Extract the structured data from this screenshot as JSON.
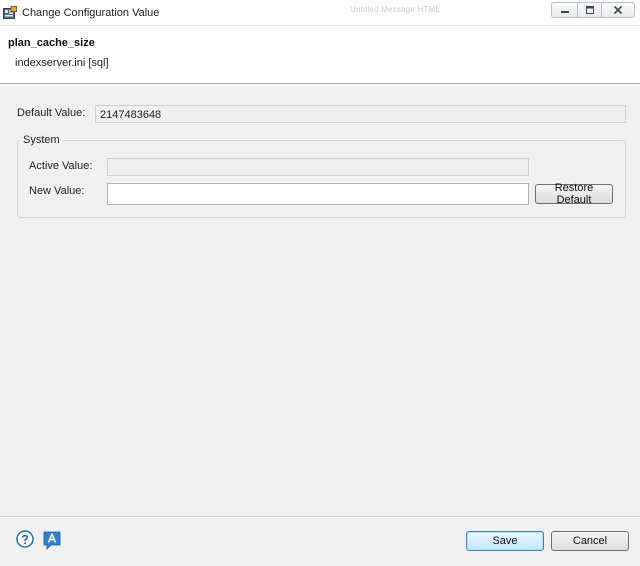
{
  "window": {
    "title": "Change Configuration Value",
    "background_hint": "Untitled Message HTML",
    "controls": {
      "minimize": "minimize-icon",
      "maximize": "maximize-icon",
      "close": "close-icon"
    }
  },
  "header": {
    "parameter_name": "plan_cache_size",
    "file_section": "indexserver.ini [sql]"
  },
  "form": {
    "default_value_label": "Default Value:",
    "default_value": "2147483648",
    "group_title": "System",
    "active_value_label": "Active Value:",
    "active_value": "",
    "new_value_label": "New Value:",
    "new_value": "",
    "restore_default_label": "Restore Default"
  },
  "footer": {
    "help_icon": "help-icon",
    "assist_icon": "a-icon",
    "save_label": "Save",
    "cancel_label": "Cancel"
  },
  "colors": {
    "dialog_background": "#f0f0f0",
    "save_button_accent": "#3c7fb1",
    "help_icon_color": "#1f6fb5"
  }
}
